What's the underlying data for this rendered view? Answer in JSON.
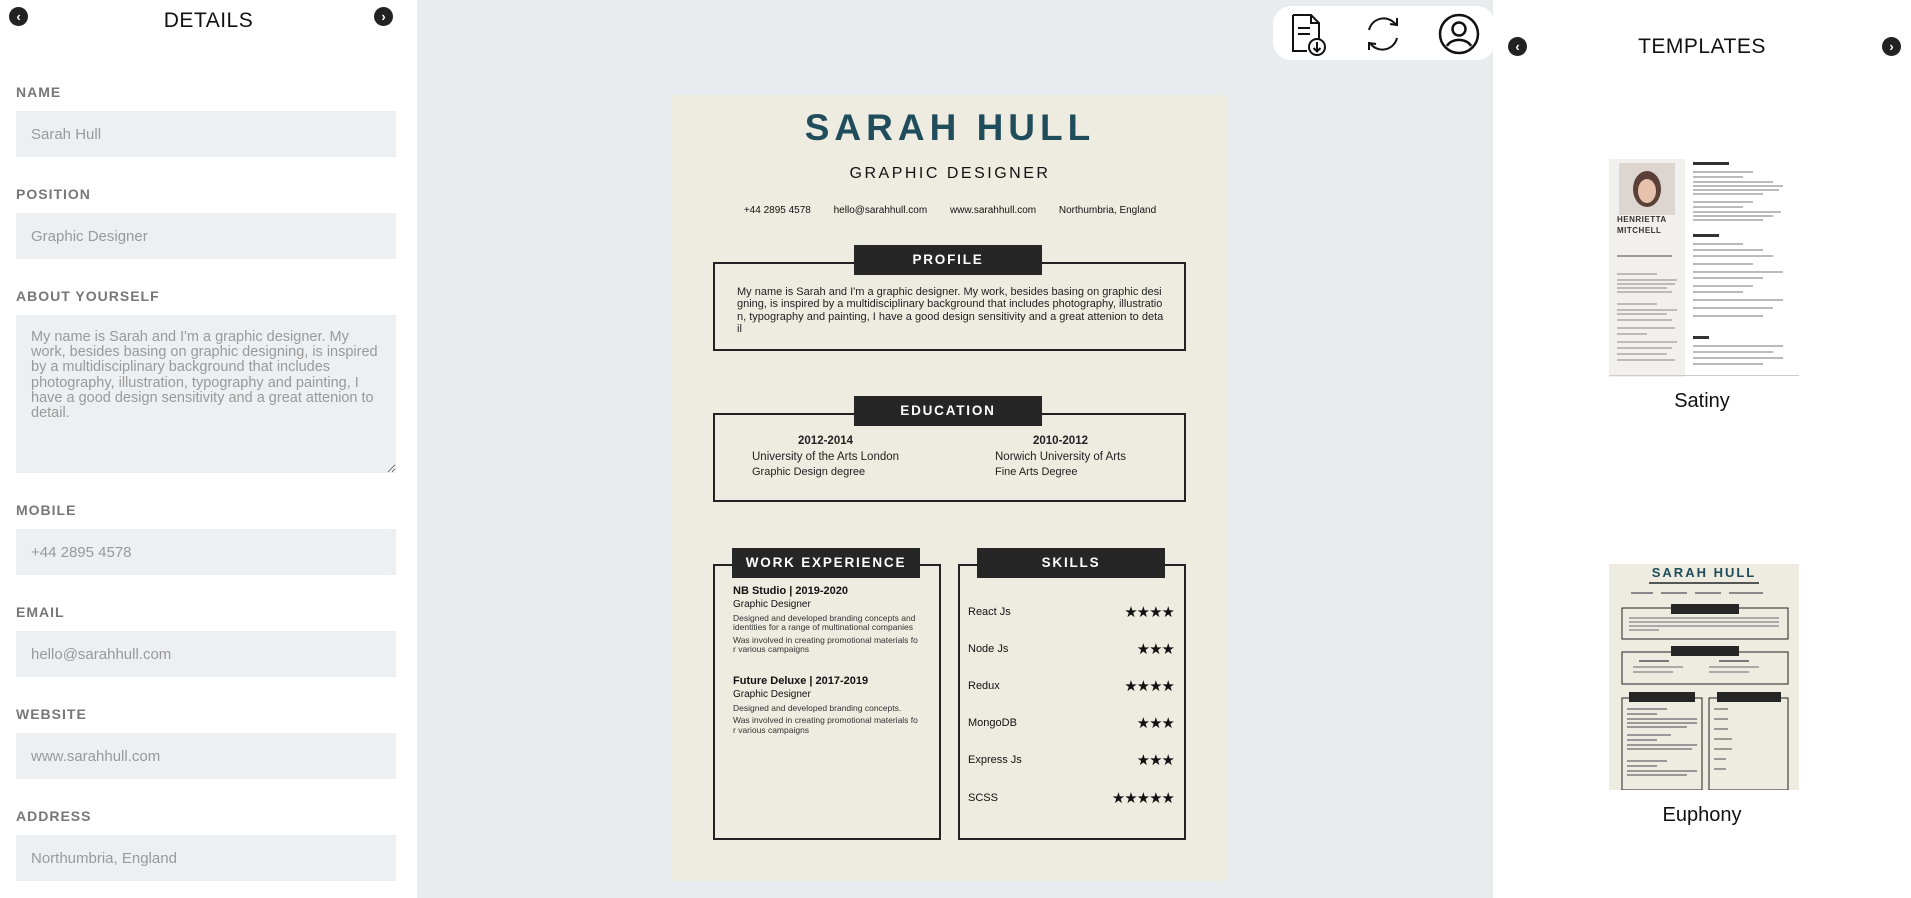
{
  "details": {
    "title": "DETAILS",
    "fields": {
      "name": {
        "label": "NAME",
        "value": "Sarah Hull"
      },
      "position": {
        "label": "POSITION",
        "value": "Graphic Designer"
      },
      "about": {
        "label": "ABOUT YOURSELF",
        "value": "My name is Sarah and I'm a graphic designer. My work, besides basing on graphic designing, is inspired by a multidisciplinary background that includes photography, illustration, typography and painting, I have a good design sensitivity and a great attenion to detail."
      },
      "mobile": {
        "label": "MOBILE",
        "value": "+44 2895 4578"
      },
      "email": {
        "label": "EMAIL",
        "value": "hello@sarahhull.com"
      },
      "website": {
        "label": "WEBSITE",
        "value": "www.sarahhull.com"
      },
      "address": {
        "label": "ADDRESS",
        "value": "Northumbria, England"
      }
    }
  },
  "toolbar": {
    "icons": [
      "download-document-icon",
      "refresh-icon",
      "user-profile-icon"
    ]
  },
  "resume": {
    "name": "SARAH HULL",
    "position": "GRAPHIC DESIGNER",
    "contacts": {
      "phone": "+44 2895 4578",
      "email": "hello@sarahhull.com",
      "website": "www.sarahhull.com",
      "address": "Northumbria, England"
    },
    "profile": {
      "heading": "PROFILE",
      "text": "My name is Sarah and I'm a graphic designer. My work, besides basing on graphic designing, is inspired by a multidisciplinary background that includes photography, illustration, typography and painting, I have a good design sensitivity and a great attenion to detail"
    },
    "education": {
      "heading": "EDUCATION",
      "items": [
        {
          "years": "2012-2014",
          "school": "University of the Arts London",
          "degree": "Graphic Design degree"
        },
        {
          "years": "2010-2012",
          "school": "Norwich University of Arts",
          "degree": "Fine Arts Degree"
        }
      ]
    },
    "work": {
      "heading": "WORK EXPERIENCE",
      "jobs": [
        {
          "title": "NB Studio | 2019-2020",
          "role": "Graphic Designer",
          "desc": [
            "Designed and developed branding concepts and identities for a range of multinational companies",
            "Was involved in creating promotional materials for various campaigns"
          ]
        },
        {
          "title": "Future Deluxe | 2017-2019",
          "role": "Graphic Designer",
          "desc": [
            "Designed and developed branding concepts.",
            "Was involved in creating promotional materials for various campaigns"
          ]
        }
      ]
    },
    "skills": {
      "heading": "SKILLS",
      "items": [
        {
          "name": "React Js",
          "stars": "★★★★",
          "rating": 4
        },
        {
          "name": "Node Js",
          "stars": "★★★",
          "rating": 3
        },
        {
          "name": "Redux",
          "stars": "★★★★",
          "rating": 4
        },
        {
          "name": "MongoDB",
          "stars": "★★★",
          "rating": 3
        },
        {
          "name": "Express Js",
          "stars": "★★★",
          "rating": 3
        },
        {
          "name": "SCSS",
          "stars": "★★★★★",
          "rating": 5
        }
      ]
    }
  },
  "templates": {
    "title": "TEMPLATES",
    "items": [
      {
        "name": "Satiny",
        "preview_name": "HENRIETTA MITCHELL"
      },
      {
        "name": "Euphony",
        "preview_name": "SARAH HULL"
      }
    ]
  },
  "colors": {
    "accent": "#1f4d5b",
    "paper": "#eeebe1",
    "dark": "#262626",
    "input_bg": "#edf0f3"
  }
}
